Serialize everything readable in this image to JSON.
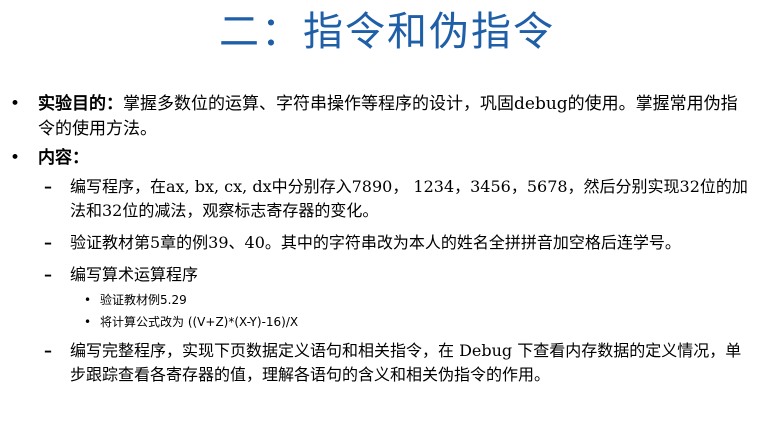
{
  "title": "二：指令和伪指令",
  "glyphs": {
    "bullet": "•",
    "dash": "–",
    "sub_bullet": "•"
  },
  "items": [
    {
      "label": "实验目的：",
      "text": "掌握多数位的运算、字符串操作等程序的设计，巩固debug的使用。掌握常用伪指令的使用方法。"
    },
    {
      "label": "内容：",
      "text": ""
    }
  ],
  "content_items": [
    {
      "text": "编写程序，在ax, bx, cx, dx中分别存入7890， 1234，3456，5678，然后分别实现32位的加法和32位的减法，观察标志寄存器的变化。"
    },
    {
      "text": "验证教材第5章的例39、40。其中的字符串改为本人的姓名全拼拼音加空格后连学号。"
    },
    {
      "text": "编写算术运算程序"
    },
    {
      "text": "编写完整程序，实现下页数据定义语句和相关指令，在 Debug 下查看内存数据的定义情况，单步跟踪查看各寄存器的值，理解各语句的含义和相关伪指令的作用。"
    }
  ],
  "arith_subitems": [
    {
      "text": "验证教材例5.29"
    },
    {
      "text": "将计算公式改为 ((V+Z)*(X-Y)-16)/X"
    }
  ]
}
